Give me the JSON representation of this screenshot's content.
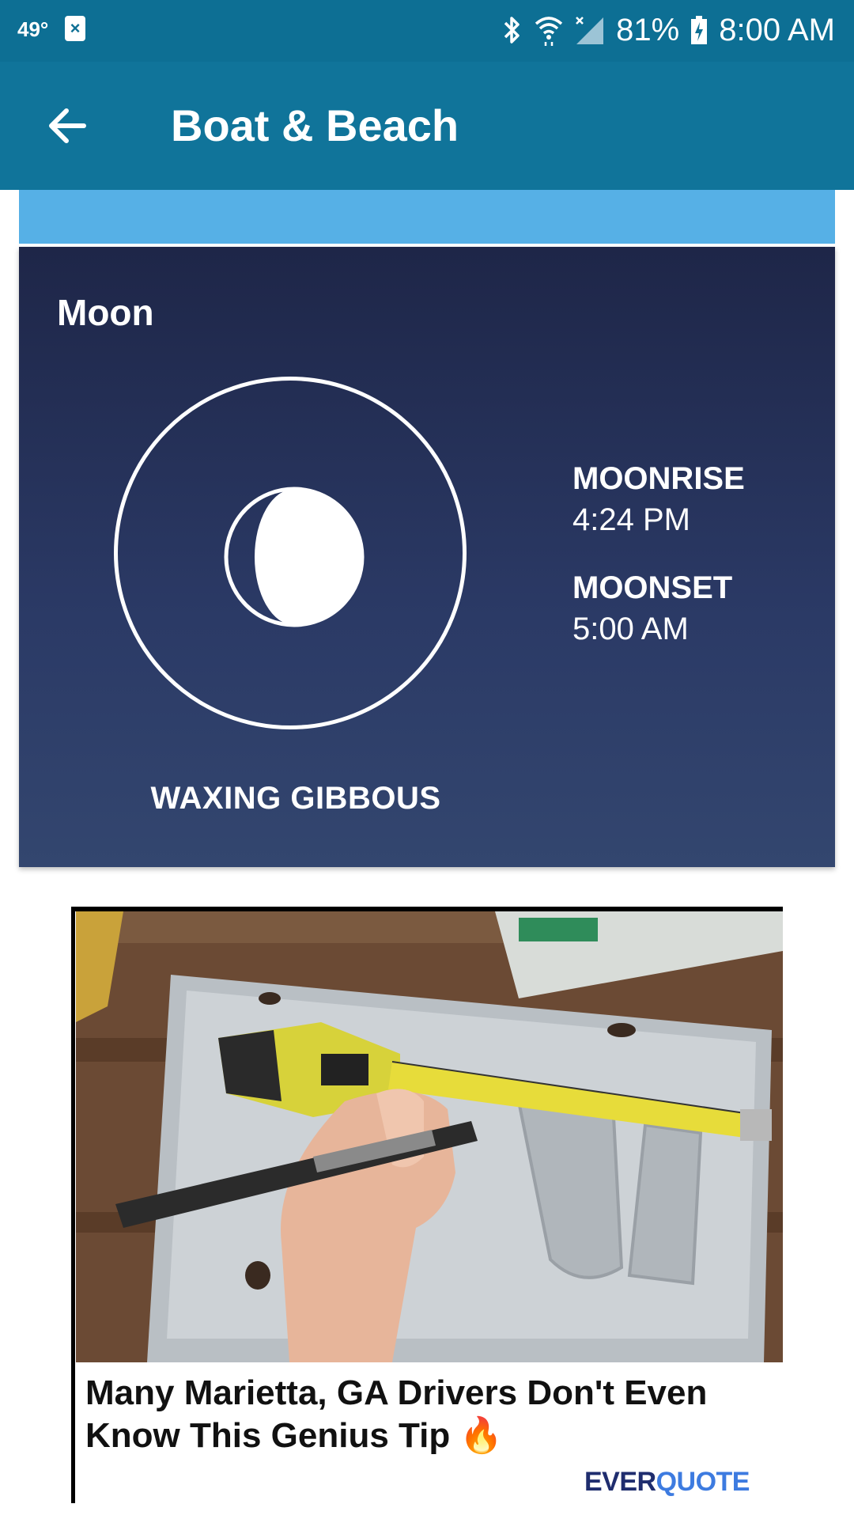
{
  "status_bar": {
    "temperature": "49°",
    "battery": "81%",
    "time": "8:00 AM",
    "icons": [
      "notification-x-icon",
      "bluetooth-icon",
      "wifi-icon",
      "no-signal-icon",
      "battery-charging-icon"
    ]
  },
  "app_bar": {
    "title": "Boat & Beach",
    "back_icon": "back-arrow-icon"
  },
  "moon": {
    "title": "Moon",
    "phase": "WAXING GIBBOUS",
    "moonrise_label": "MOONRISE",
    "moonrise_time": "4:24 PM",
    "moonset_label": "MOONSET",
    "moonset_time": "5:00 AM"
  },
  "ad": {
    "headline": "Many Marietta, GA Drivers Don't Even Know This Genius Tip 🔥",
    "brand_part1": "EVER",
    "brand_part2": "QUOTE"
  },
  "colors": {
    "status_bar": "#0d6f94",
    "app_bar": "#10749a",
    "strip": "#56b0e6",
    "card_top": "#1e2648",
    "card_bottom": "#33466f"
  }
}
